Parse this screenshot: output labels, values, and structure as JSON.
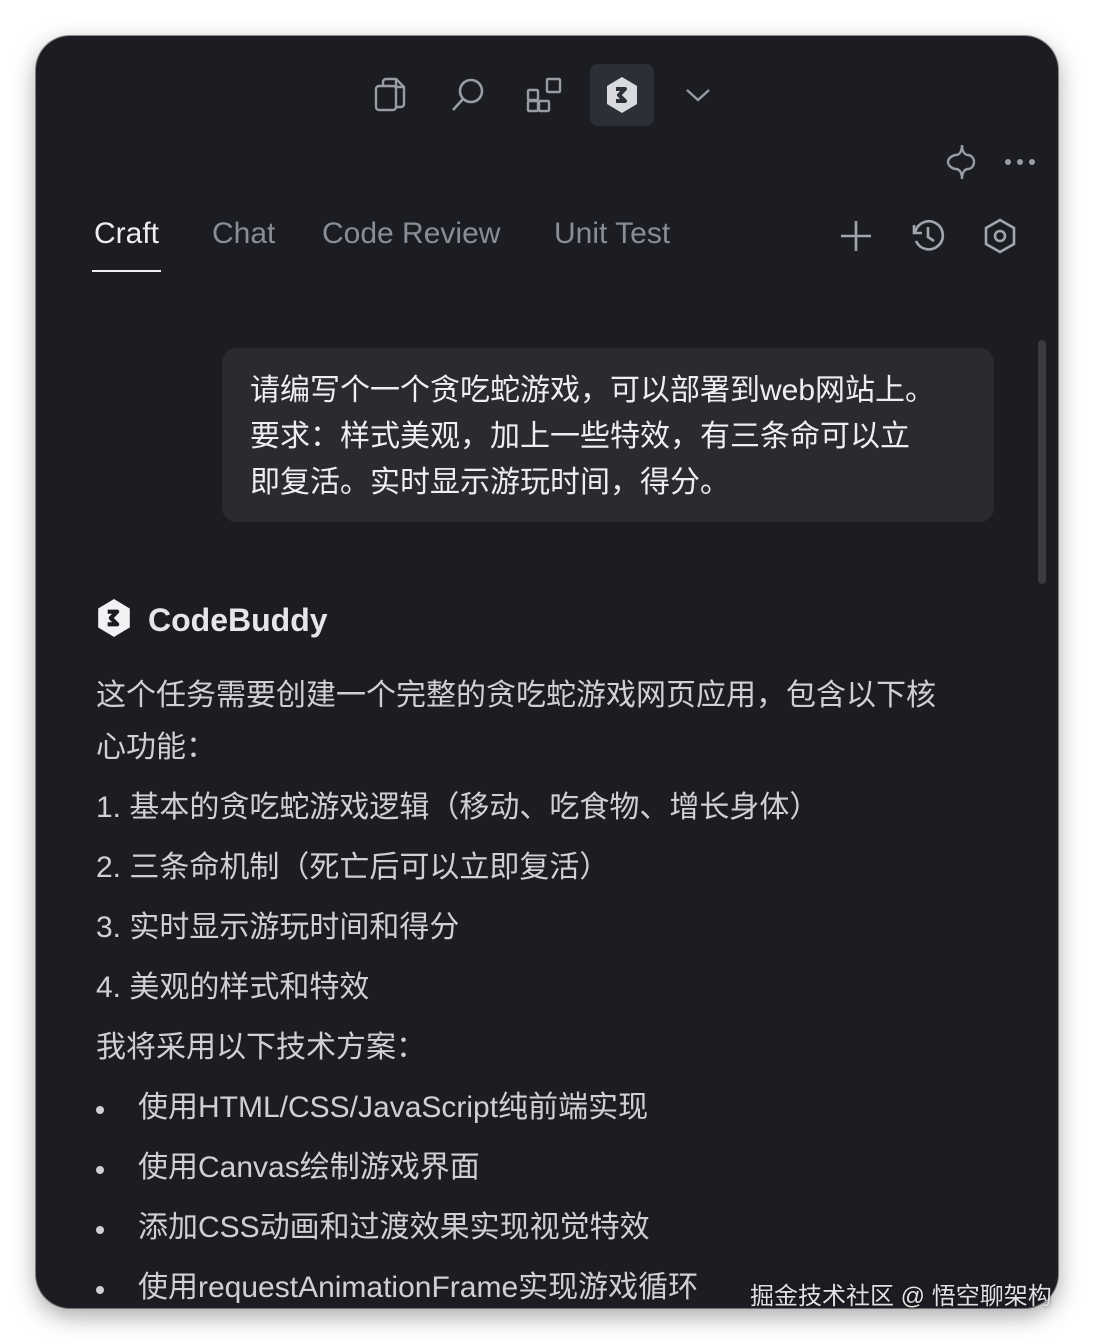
{
  "toolbar": {
    "icons": [
      "copy-icon",
      "search-icon",
      "extensions-icon",
      "codebuddy-logo-icon",
      "chevron-down-icon"
    ]
  },
  "header_actions": [
    "ai-sparkle-icon",
    "more-icon"
  ],
  "tabs": [
    {
      "label": "Craft",
      "active": true
    },
    {
      "label": "Chat",
      "active": false
    },
    {
      "label": "Code Review",
      "active": false
    },
    {
      "label": "Unit Test",
      "active": false
    }
  ],
  "tab_actions": [
    "plus-icon",
    "history-icon",
    "settings-icon"
  ],
  "user_message": {
    "lines": [
      "请编写个一个贪吃蛇游戏，可以部署到web网站上。",
      "要求：样式美观，加上一些特效，有三条命可以立",
      "即复活。实时显示游玩时间，得分。"
    ]
  },
  "assistant": {
    "name": "CodeBuddy",
    "intro_lines": [
      "这个任务需要创建一个完整的贪吃蛇游戏网页应用，包含以下核",
      "心功能："
    ],
    "numbered": [
      "1. 基本的贪吃蛇游戏逻辑（移动、吃食物、增长身体）",
      "2. 三条命机制（死亡后可以立即复活）",
      "3. 实时显示游玩时间和得分",
      "4. 美观的样式和特效"
    ],
    "tech_heading": "我将采用以下技术方案：",
    "bullets": [
      "使用HTML/CSS/JavaScript纯前端实现",
      "使用Canvas绘制游戏界面",
      "添加CSS动画和过渡效果实现视觉特效",
      "使用requestAnimationFrame实现游戏循环"
    ]
  },
  "watermark": "掘金技术社区 @ 悟空聊架构",
  "colors": {
    "background": "#1c1d22",
    "bubble": "#2a2b30",
    "text": "#cfd0d6",
    "tab_inactive": "#8b8d96",
    "tab_active": "#eeeef2"
  }
}
